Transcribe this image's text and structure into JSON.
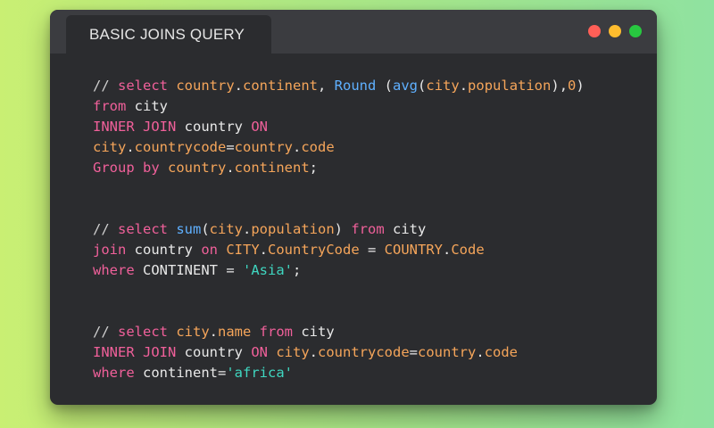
{
  "window": {
    "tab_title": "BASIC JOINS QUERY",
    "dots": [
      {
        "name": "close",
        "color": "#ff5f57"
      },
      {
        "name": "minimize",
        "color": "#febc2e"
      },
      {
        "name": "maximize",
        "color": "#28c840"
      }
    ]
  },
  "syntax_colors": {
    "comment": "#cfcfcf",
    "keyword": "#f0609a",
    "function": "#5fb0ff",
    "identifier": "#f5a55a",
    "plain": "#e8e8e8",
    "string": "#3fd6c0"
  },
  "code": {
    "lines": [
      [
        [
          "// ",
          "comment"
        ],
        [
          "select ",
          "keyword"
        ],
        [
          "country",
          "identifier"
        ],
        [
          ".",
          "plain"
        ],
        [
          "continent",
          "identifier"
        ],
        [
          ", ",
          "plain"
        ],
        [
          "Round",
          "function"
        ],
        [
          " (",
          "plain"
        ],
        [
          "avg",
          "function"
        ],
        [
          "(",
          "plain"
        ],
        [
          "city",
          "identifier"
        ],
        [
          ".",
          "plain"
        ],
        [
          "population",
          "identifier"
        ],
        [
          "),",
          "plain"
        ],
        [
          "0",
          "identifier"
        ],
        [
          ")",
          "plain"
        ]
      ],
      [
        [
          "from",
          "keyword"
        ],
        [
          " city",
          "plain"
        ]
      ],
      [
        [
          "INNER JOIN",
          "keyword"
        ],
        [
          " country ",
          "plain"
        ],
        [
          "ON",
          "keyword"
        ]
      ],
      [
        [
          "city",
          "identifier"
        ],
        [
          ".",
          "plain"
        ],
        [
          "countrycode",
          "identifier"
        ],
        [
          "=",
          "plain"
        ],
        [
          "country",
          "identifier"
        ],
        [
          ".",
          "plain"
        ],
        [
          "code",
          "identifier"
        ]
      ],
      [
        [
          "Group by",
          "keyword"
        ],
        [
          " ",
          "plain"
        ],
        [
          "country",
          "identifier"
        ],
        [
          ".",
          "plain"
        ],
        [
          "continent",
          "identifier"
        ],
        [
          ";",
          "plain"
        ]
      ],
      [],
      [],
      [
        [
          "// ",
          "comment"
        ],
        [
          "select ",
          "keyword"
        ],
        [
          "sum",
          "function"
        ],
        [
          "(",
          "plain"
        ],
        [
          "city",
          "identifier"
        ],
        [
          ".",
          "plain"
        ],
        [
          "population",
          "identifier"
        ],
        [
          ") ",
          "plain"
        ],
        [
          "from",
          "keyword"
        ],
        [
          " city",
          "plain"
        ]
      ],
      [
        [
          "join",
          "keyword"
        ],
        [
          " country ",
          "plain"
        ],
        [
          "on",
          "keyword"
        ],
        [
          " ",
          "plain"
        ],
        [
          "CITY",
          "identifier"
        ],
        [
          ".",
          "plain"
        ],
        [
          "CountryCode",
          "identifier"
        ],
        [
          " = ",
          "plain"
        ],
        [
          "COUNTRY",
          "identifier"
        ],
        [
          ".",
          "plain"
        ],
        [
          "Code",
          "identifier"
        ]
      ],
      [
        [
          "where",
          "keyword"
        ],
        [
          " CONTINENT = ",
          "plain"
        ],
        [
          "'Asia'",
          "string"
        ],
        [
          ";",
          "plain"
        ]
      ],
      [],
      [],
      [
        [
          "// ",
          "comment"
        ],
        [
          "select ",
          "keyword"
        ],
        [
          "city",
          "identifier"
        ],
        [
          ".",
          "plain"
        ],
        [
          "name",
          "identifier"
        ],
        [
          " ",
          "plain"
        ],
        [
          "from",
          "keyword"
        ],
        [
          " city",
          "plain"
        ]
      ],
      [
        [
          "INNER JOIN",
          "keyword"
        ],
        [
          " country ",
          "plain"
        ],
        [
          "ON",
          "keyword"
        ],
        [
          " ",
          "plain"
        ],
        [
          "city",
          "identifier"
        ],
        [
          ".",
          "plain"
        ],
        [
          "countrycode",
          "identifier"
        ],
        [
          "=",
          "plain"
        ],
        [
          "country",
          "identifier"
        ],
        [
          ".",
          "plain"
        ],
        [
          "code",
          "identifier"
        ]
      ],
      [
        [
          "where",
          "keyword"
        ],
        [
          " continent=",
          "plain"
        ],
        [
          "'africa'",
          "string"
        ]
      ]
    ]
  }
}
